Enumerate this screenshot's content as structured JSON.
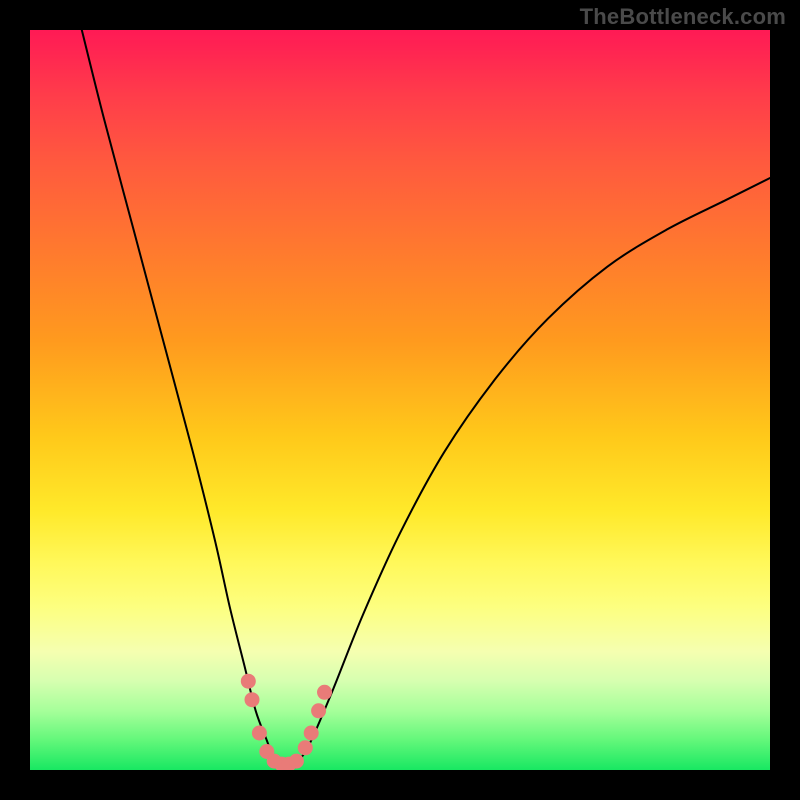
{
  "watermark": "TheBottleneck.com",
  "chart_data": {
    "type": "line",
    "title": "",
    "xlabel": "",
    "ylabel": "",
    "xlim": [
      0,
      100
    ],
    "ylim": [
      0,
      100
    ],
    "background_gradient_stops": [
      {
        "pct": 0,
        "color": "#ff1a55"
      },
      {
        "pct": 9,
        "color": "#ff3d4a"
      },
      {
        "pct": 18,
        "color": "#ff5a3e"
      },
      {
        "pct": 30,
        "color": "#ff7a2e"
      },
      {
        "pct": 42,
        "color": "#ff9a1e"
      },
      {
        "pct": 55,
        "color": "#ffc91a"
      },
      {
        "pct": 65,
        "color": "#ffe92a"
      },
      {
        "pct": 72,
        "color": "#fff85a"
      },
      {
        "pct": 78,
        "color": "#fdff80"
      },
      {
        "pct": 84,
        "color": "#f5ffb0"
      },
      {
        "pct": 88,
        "color": "#d6ffb0"
      },
      {
        "pct": 92,
        "color": "#a6ff9a"
      },
      {
        "pct": 96,
        "color": "#62f77a"
      },
      {
        "pct": 100,
        "color": "#18e862"
      }
    ],
    "series": [
      {
        "name": "bottleneck-curve",
        "color": "#000000",
        "x": [
          7,
          10,
          14,
          18,
          22,
          25,
          27,
          29,
          30.5,
          32,
          33,
          34,
          35,
          36.5,
          38,
          41,
          45,
          50,
          56,
          63,
          70,
          78,
          86,
          94,
          100
        ],
        "y": [
          100,
          88,
          73,
          58,
          43,
          31,
          22,
          14,
          8,
          4,
          1.5,
          0.5,
          0.5,
          1.5,
          4,
          11,
          21,
          32,
          43,
          53,
          61,
          68,
          73,
          77,
          80
        ]
      }
    ],
    "curve_min_x": 34,
    "highlight_dots": {
      "color": "#e97b78",
      "radius_px": 7.5,
      "points": [
        {
          "x": 29.5,
          "y": 12
        },
        {
          "x": 30.0,
          "y": 9.5
        },
        {
          "x": 31.0,
          "y": 5
        },
        {
          "x": 32.0,
          "y": 2.5
        },
        {
          "x": 33.0,
          "y": 1.2
        },
        {
          "x": 34.0,
          "y": 0.8
        },
        {
          "x": 35.0,
          "y": 0.8
        },
        {
          "x": 36.0,
          "y": 1.2
        },
        {
          "x": 37.2,
          "y": 3
        },
        {
          "x": 38.0,
          "y": 5
        },
        {
          "x": 39.0,
          "y": 8
        },
        {
          "x": 39.8,
          "y": 10.5
        }
      ]
    }
  }
}
